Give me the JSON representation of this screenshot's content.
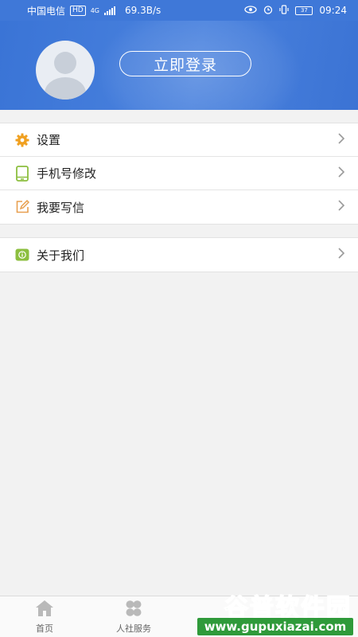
{
  "status_bar": {
    "carrier": "中国电信",
    "hd": "HD",
    "network": "4G",
    "speed": "69.3B/s",
    "battery": "37",
    "time": "09:24"
  },
  "header": {
    "login_label": "立即登录"
  },
  "menu_group_1": [
    {
      "label": "设置",
      "icon": "gear-icon",
      "color": "#f0a020"
    },
    {
      "label": "手机号修改",
      "icon": "phone-icon",
      "color": "#8cbf3f"
    },
    {
      "label": "我要写信",
      "icon": "edit-icon",
      "color": "#e8a050"
    }
  ],
  "menu_group_2": [
    {
      "label": "关于我们",
      "icon": "info-icon",
      "color": "#8cbf3f"
    }
  ],
  "tabbar": {
    "tabs": [
      {
        "label": "首页",
        "icon": "home-icon"
      },
      {
        "label": "人社服务",
        "icon": "services-icon"
      }
    ]
  },
  "watermark": {
    "title": "谷普软件园",
    "url": "www.gupuxiazai.com"
  },
  "colors": {
    "header_blue": "#3f78d8",
    "watermark_green": "#2f9a3a"
  }
}
